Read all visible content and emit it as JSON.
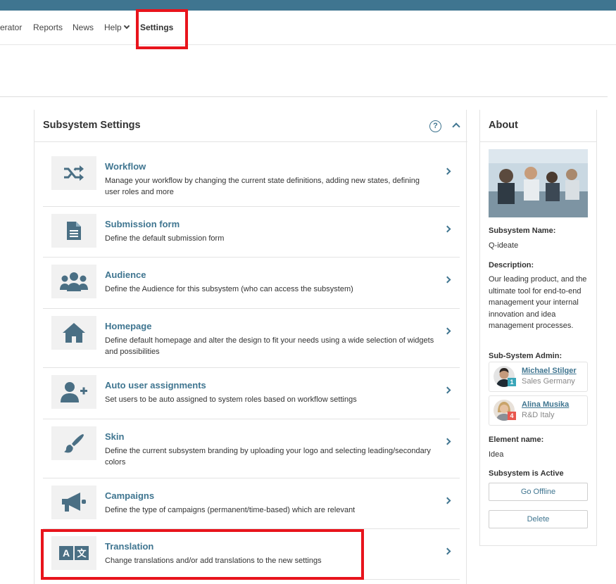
{
  "nav": {
    "items": [
      {
        "label": "erator"
      },
      {
        "label": "Reports"
      },
      {
        "label": "News"
      },
      {
        "label": "Help"
      },
      {
        "label": "Settings"
      }
    ]
  },
  "panel": {
    "title": "Subsystem Settings",
    "help": "?",
    "rows": [
      {
        "title": "Workflow",
        "desc": "Manage your workflow by changing the current state definitions, adding new states, defining user roles and more",
        "icon": "shuffle-icon"
      },
      {
        "title": "Submission form",
        "desc": "Define the default submission form",
        "icon": "document-icon"
      },
      {
        "title": "Audience",
        "desc": "Define the Audience for this subsystem (who can access the subsystem)",
        "icon": "users-icon"
      },
      {
        "title": "Homepage",
        "desc": "Define default homepage and alter the design to fit your needs using a wide selection of widgets and possibilities",
        "icon": "home-icon"
      },
      {
        "title": "Auto user assignments",
        "desc": "Set users to be auto assigned to system roles based on workflow settings",
        "icon": "user-plus-icon"
      },
      {
        "title": "Skin",
        "desc": "Define the current subsystem branding by uploading your logo and selecting leading/secondary colors",
        "icon": "paintbrush-icon"
      },
      {
        "title": "Campaigns",
        "desc": "Define the type of campaigns (permanent/time-based) which are relevant",
        "icon": "megaphone-icon"
      },
      {
        "title": "Translation",
        "desc": "Change translations and/or add translations to the new settings",
        "icon": "translate-icon"
      }
    ]
  },
  "about": {
    "title": "About",
    "subsystem_name_label": "Subsystem Name:",
    "subsystem_name": "Q-ideate",
    "description_label": "Description:",
    "description": "Our leading product, and the ultimate tool for end-to-end management your internal innovation and idea management processes.",
    "admin_label": "Sub-System Admin:",
    "admins": [
      {
        "name": "Michael Stilger",
        "dept": "Sales Germany",
        "badge": "1",
        "badge_color": "#3aa6b9"
      },
      {
        "name": "Alina Musika",
        "dept": "R&D Italy",
        "badge": "4",
        "badge_color": "#e8584f"
      }
    ],
    "element_name_label": "Element name:",
    "element_name": "Idea",
    "active_label": "Subsystem is Active",
    "go_offline": "Go Offline",
    "delete": "Delete"
  },
  "colors": {
    "accent": "#3f7590",
    "highlight": "#e8141c",
    "topbar": "#3f7590"
  }
}
